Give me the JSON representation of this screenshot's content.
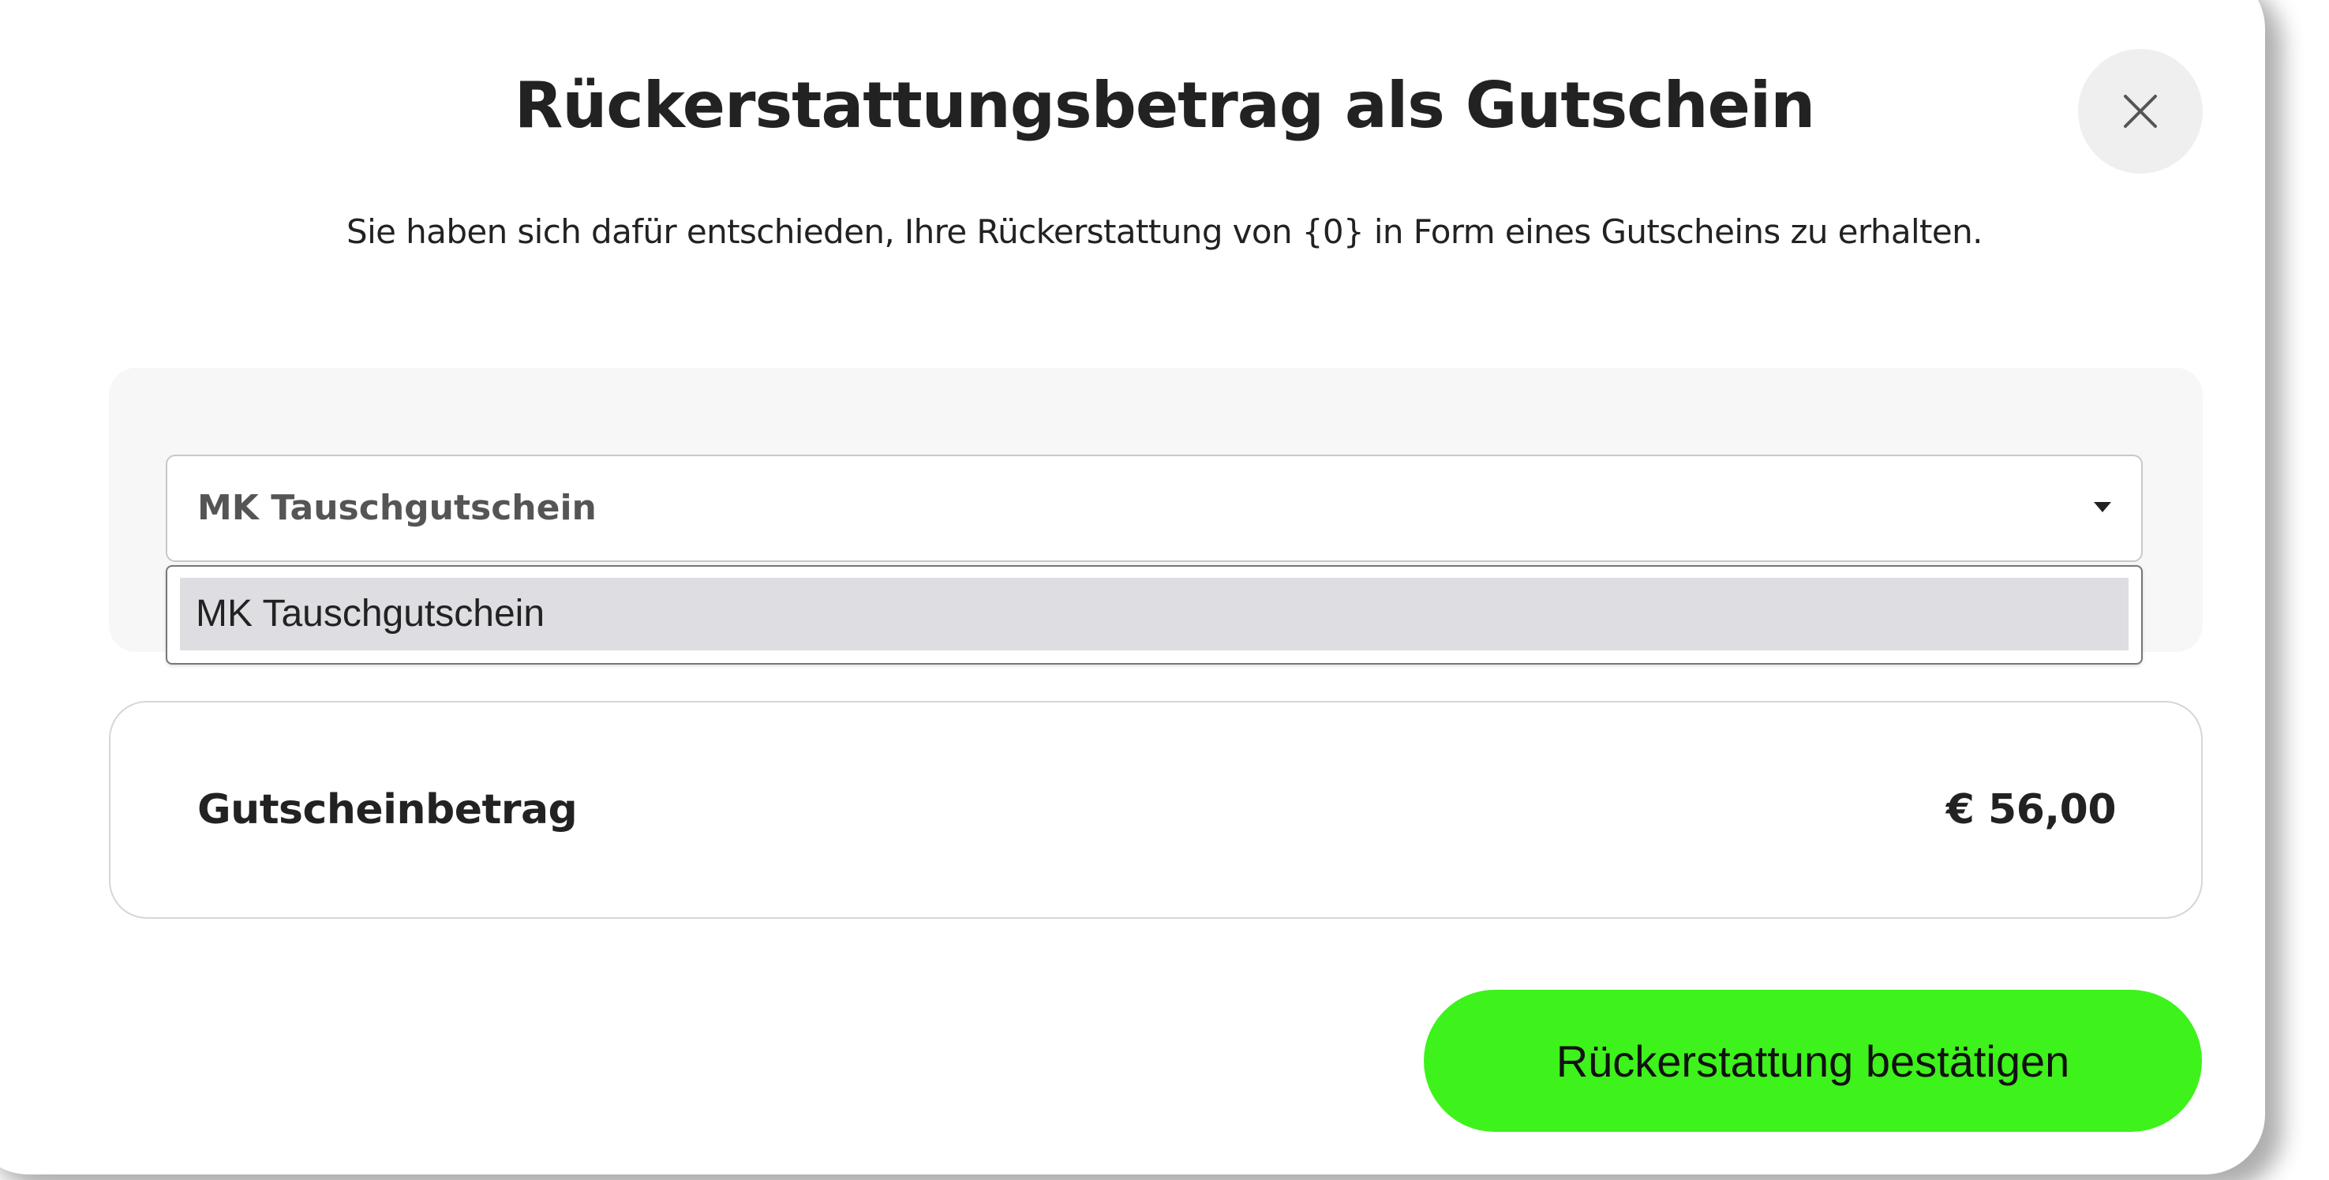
{
  "dialog": {
    "title": "Rückerstattungsbetrag als Gutschein",
    "subtitle": "Sie haben sich dafür entschieden, Ihre Rückerstattung von {0} in Form eines Gutscheins zu erhalten.",
    "close_icon": "close-icon"
  },
  "voucher_select": {
    "selected_value": "MK Tauschgutschein",
    "options": [
      {
        "label": "MK Tauschgutschein",
        "highlighted": true
      }
    ],
    "arrow_icon": "caret-down-icon"
  },
  "summary": {
    "label": "Gutscheinbetrag",
    "amount": "€ 56,00"
  },
  "actions": {
    "confirm_label": "Rückerstattung bestätigen"
  },
  "colors": {
    "accent": "#3EF21C",
    "text": "#222222",
    "panel_background": "#F7F7F7",
    "option_highlight": "#DDDDE2"
  }
}
